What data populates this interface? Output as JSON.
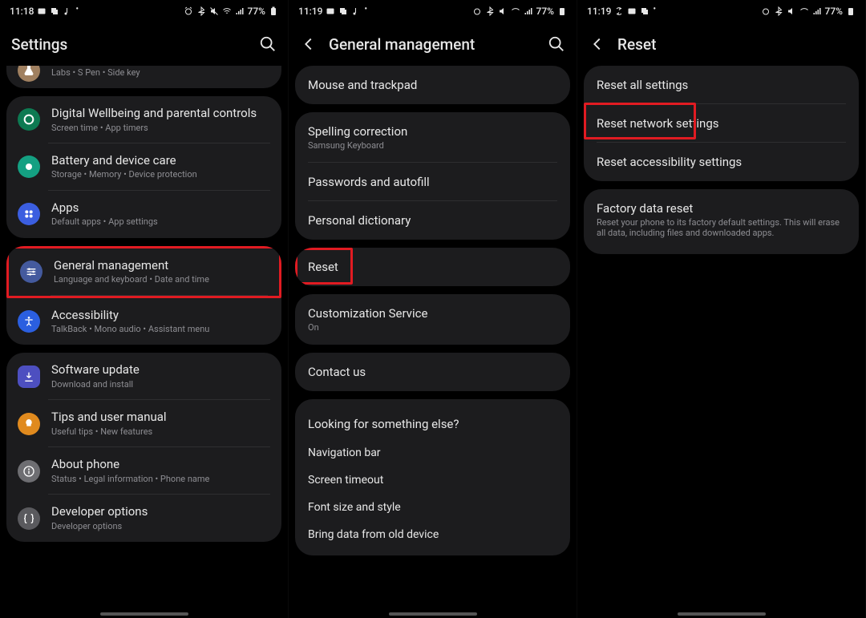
{
  "screens": [
    {
      "status": {
        "time": "11:18",
        "battery": "77%"
      },
      "title": "Settings",
      "groups": [
        {
          "kind": "partial",
          "items": [
            {
              "icon": "af",
              "title": "",
              "subtitle": "Labs  •  S Pen  •  Side key"
            }
          ]
        },
        {
          "items": [
            {
              "icon": "dw",
              "title": "Digital Wellbeing and parental controls",
              "subtitle": "Screen time  •  App timers"
            },
            {
              "icon": "bd",
              "title": "Battery and device care",
              "subtitle": "Storage  •  Memory  •  Device protection"
            },
            {
              "icon": "ap",
              "title": "Apps",
              "subtitle": "Default apps  •  App settings"
            }
          ]
        },
        {
          "items": [
            {
              "icon": "gm",
              "title": "General management",
              "subtitle": "Language and keyboard  •  Date and time",
              "highlight": true
            },
            {
              "icon": "ac",
              "title": "Accessibility",
              "subtitle": "TalkBack  •  Mono audio  •  Assistant menu"
            }
          ]
        },
        {
          "items": [
            {
              "icon": "su",
              "title": "Software update",
              "subtitle": "Download and install"
            },
            {
              "icon": "tu",
              "title": "Tips and user manual",
              "subtitle": "Useful tips  •  New features"
            },
            {
              "icon": "ab",
              "title": "About phone",
              "subtitle": "Status  •  Legal information  •  Phone name"
            },
            {
              "icon": "do",
              "title": "Developer options",
              "subtitle": "Developer options"
            }
          ]
        }
      ]
    },
    {
      "status": {
        "time": "11:19",
        "battery": "77%"
      },
      "title": "General management",
      "back": true,
      "search": true,
      "groups": [
        {
          "simple": true,
          "items": [
            {
              "title": "Mouse and trackpad"
            }
          ]
        },
        {
          "simple": true,
          "items": [
            {
              "title": "Spelling correction",
              "subtitle": "Samsung Keyboard"
            },
            {
              "title": "Passwords and autofill"
            },
            {
              "title": "Personal dictionary"
            }
          ]
        },
        {
          "simple": true,
          "items": [
            {
              "title": "Reset",
              "highlight": true
            }
          ]
        },
        {
          "simple": true,
          "items": [
            {
              "title": "Customization Service",
              "subtitle": "On"
            }
          ]
        },
        {
          "simple": true,
          "items": [
            {
              "title": "Contact us"
            }
          ]
        },
        {
          "looking": true,
          "header": "Looking for something else?",
          "items": [
            {
              "title": "Navigation bar"
            },
            {
              "title": "Screen timeout"
            },
            {
              "title": "Font size and style"
            },
            {
              "title": "Bring data from old device"
            }
          ]
        }
      ]
    },
    {
      "status": {
        "time": "11:19",
        "battery": "77%"
      },
      "title": "Reset",
      "back": true,
      "groups": [
        {
          "simple": true,
          "items": [
            {
              "title": "Reset all settings"
            },
            {
              "title": "Reset network settings",
              "highlight": true
            },
            {
              "title": "Reset accessibility settings"
            }
          ]
        },
        {
          "simple": true,
          "items": [
            {
              "title": "Factory data reset",
              "subtitle": "Reset your phone to its factory default settings. This will erase all data, including files and downloaded apps."
            }
          ]
        }
      ]
    }
  ]
}
